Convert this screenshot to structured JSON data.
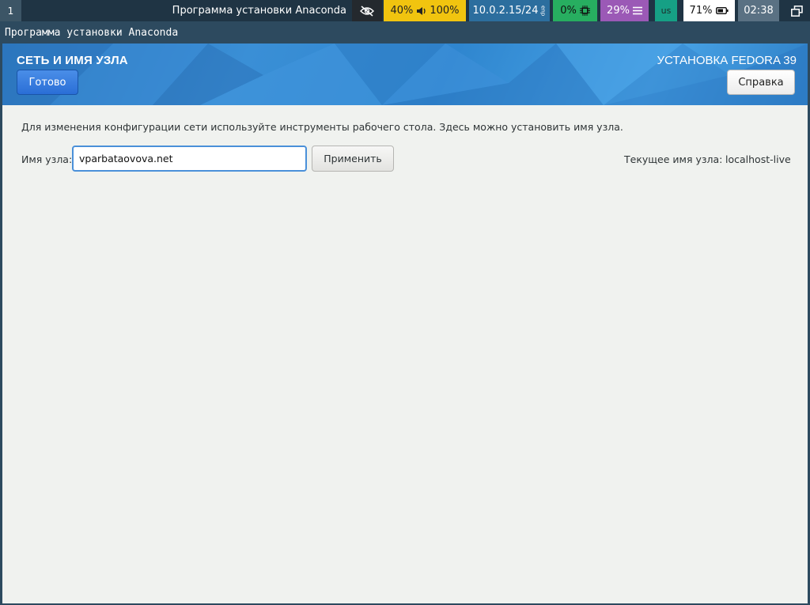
{
  "topbar": {
    "workspace": "1",
    "window_title": "Программа установки Anaconda",
    "audio": {
      "mic": "40%",
      "volume": "100%"
    },
    "network": {
      "ip": "10.0.2.15/24",
      "sub": "enp"
    },
    "cpu": "0%",
    "memory": "29%",
    "keyboard": "us",
    "battery": "71%",
    "clock": "02:38"
  },
  "app_title": "Программа установки Anaconda",
  "header": {
    "spoke_title": "СЕТЬ И ИМЯ УЗЛА",
    "product_title": "УСТАНОВКА FEDORA 39",
    "done_label": "Готово",
    "help_label": "Справка"
  },
  "content": {
    "description": "Для изменения конфигурации сети используйте инструменты рабочего стола. Здесь можно установить имя узла.",
    "hostname_label": "Имя узла:",
    "hostname_value": "vparbataovova.net",
    "apply_label": "Применить",
    "current_label": "Текущее имя узла:",
    "current_value": "localhost-live"
  },
  "colors": {
    "accent": "#2a6ed6",
    "header_blue": "#3a8fd6",
    "content_bg": "#f0f2ef",
    "focus_border": "#4a90d9"
  }
}
